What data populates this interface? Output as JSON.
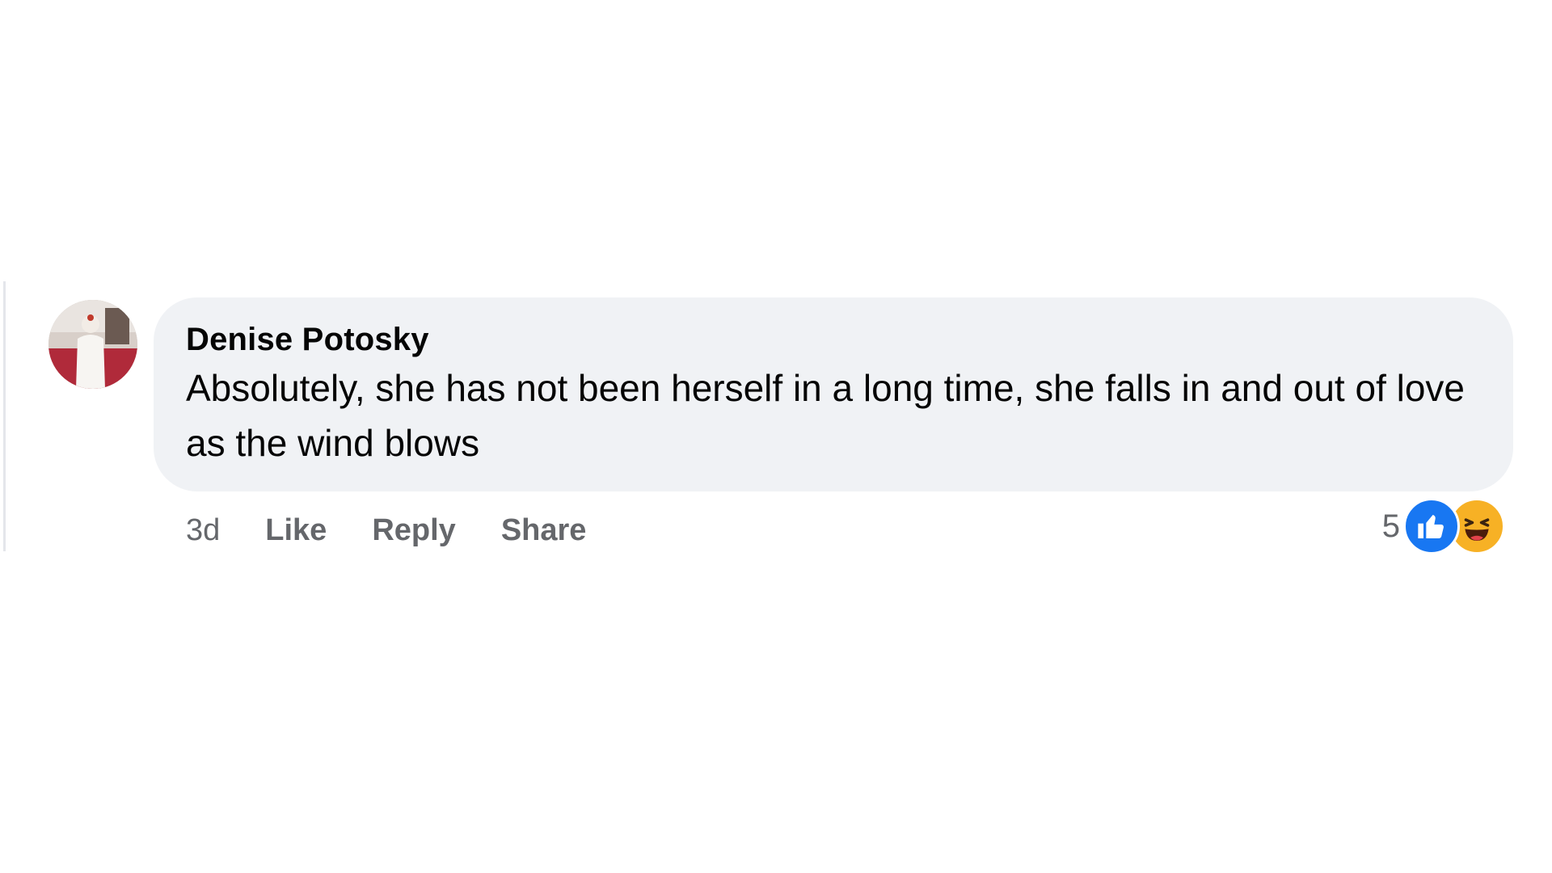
{
  "comment": {
    "author": "Denise Potosky",
    "text": "Absolutely, she has not been herself in a long time, she falls in and out of love as the wind blows",
    "avatar_icon": "profile-photo",
    "actions": {
      "timestamp": "3d",
      "like_label": "Like",
      "reply_label": "Reply",
      "share_label": "Share"
    },
    "reactions": {
      "count": "5",
      "types": [
        "like-icon",
        "haha-icon"
      ]
    }
  },
  "colors": {
    "bubble": "#f0f2f5",
    "secondary_text": "#65676b",
    "like_blue": "#1877f2",
    "haha_yellow": "#f7b125"
  }
}
